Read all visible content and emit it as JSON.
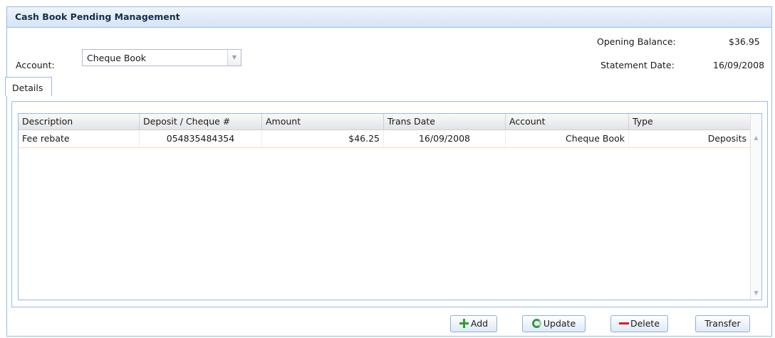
{
  "panel": {
    "title": "Cash Book Pending Management"
  },
  "form": {
    "account_label": "Account:",
    "account_value": "Cheque Book",
    "opening_balance_label": "Opening Balance:",
    "opening_balance_value": "$36.95",
    "statement_date_label": "Statement Date:",
    "statement_date_value": "16/09/2008"
  },
  "tabs": [
    {
      "label": "Details",
      "active": true
    }
  ],
  "grid": {
    "columns": [
      "Description",
      "Deposit / Cheque #",
      "Amount",
      "Trans Date",
      "Account",
      "Type"
    ],
    "rows": [
      {
        "description": "Fee rebate",
        "deposit_cheque": "054835484354",
        "amount": "$46.25",
        "trans_date": "16/09/2008",
        "account": "Cheque Book",
        "type": "Deposits"
      }
    ]
  },
  "buttons": {
    "add": "Add",
    "update": "Update",
    "delete": "Delete",
    "transfer": "Transfer"
  },
  "icons": {
    "add": "plus-icon",
    "update": "refresh-icon",
    "delete": "minus-icon"
  },
  "colors": {
    "header_border": "#99bbe8",
    "row_border": "#fadfc0",
    "add_icon": "#2aa52a",
    "delete_icon": "#d62020"
  }
}
